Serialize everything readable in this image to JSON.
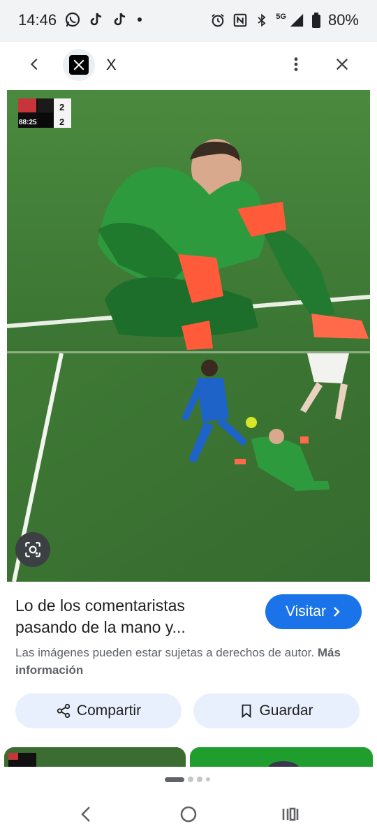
{
  "status_bar": {
    "time": "14:46",
    "network": "5G",
    "battery": "80%",
    "left_icons": [
      "whatsapp-icon",
      "tiktok-icon",
      "tiktok-icon",
      "dot-icon"
    ],
    "right_icons": [
      "alarm-icon",
      "nfc-icon",
      "bluetooth-icon",
      "signal-icon",
      "battery-icon"
    ]
  },
  "top_bar": {
    "site_name": "X",
    "favicon": "x-logo-icon"
  },
  "image": {
    "scoreboard": {
      "time": "88:25",
      "score_home": "2",
      "score_away": "2"
    }
  },
  "result": {
    "title": "Lo de los comentaristas pasando de la mano y...",
    "visit_label": "Visitar",
    "rights_text": "Las imágenes pueden estar sujetas a derechos de autor.",
    "more_info_label": "Más información"
  },
  "actions": {
    "share_label": "Compartir",
    "save_label": "Guardar"
  },
  "colors": {
    "accent": "#1a73e8",
    "pill_bg": "#e8f0fe",
    "status_bg": "#f1f3f4"
  }
}
